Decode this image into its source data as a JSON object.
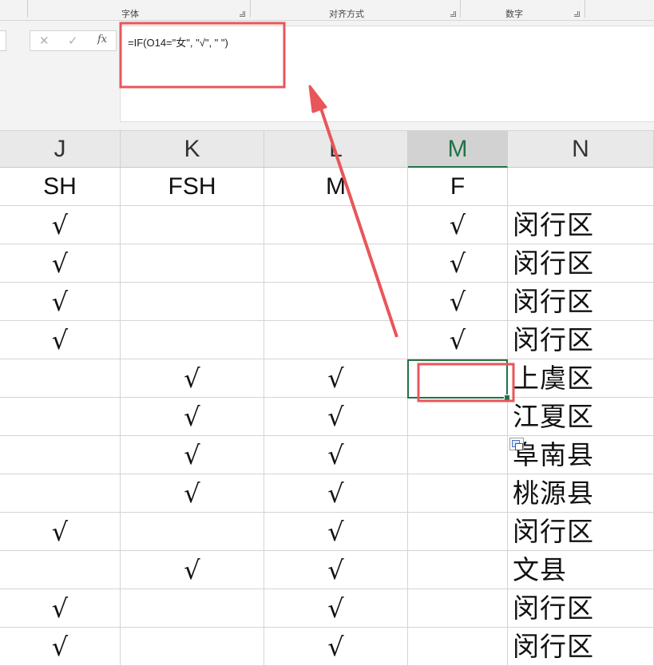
{
  "ribbon": {
    "groups": [
      {
        "label": "字体"
      },
      {
        "label": "对齐方式"
      },
      {
        "label": "数字"
      }
    ]
  },
  "formula_bar": {
    "cancel_icon": "✕",
    "enter_icon": "✓",
    "function_icon": "fx",
    "formula": "=IF(O14=\"女\", \"√\", \" \")"
  },
  "columns": [
    {
      "id": "J",
      "label": "J"
    },
    {
      "id": "K",
      "label": "K"
    },
    {
      "id": "L",
      "label": "L"
    },
    {
      "id": "M",
      "label": "M",
      "selected": true
    },
    {
      "id": "N",
      "label": "N"
    }
  ],
  "header_row": [
    "SH",
    "FSH",
    "M",
    "F",
    ""
  ],
  "rows": [
    [
      "√",
      "",
      "",
      "√",
      "闵行区"
    ],
    [
      "√",
      "",
      "",
      "√",
      "闵行区"
    ],
    [
      "√",
      "",
      "",
      "√",
      "闵行区"
    ],
    [
      "√",
      "",
      "",
      "√",
      "闵行区"
    ],
    [
      "",
      "√",
      "√",
      "",
      "上虞区"
    ],
    [
      "",
      "√",
      "√",
      "",
      "江夏区"
    ],
    [
      "",
      "√",
      "√",
      "",
      "阜南县"
    ],
    [
      "",
      "√",
      "√",
      "",
      "桃源县"
    ],
    [
      "√",
      "",
      "√",
      "",
      "闵行区"
    ],
    [
      "",
      "√",
      "√",
      "",
      "文县"
    ],
    [
      "√",
      "",
      "√",
      "",
      "闵行区"
    ],
    [
      "√",
      "",
      "√",
      "",
      "闵行区"
    ]
  ],
  "colors": {
    "annotation_red": "#e8565a",
    "excel_green": "#217346"
  }
}
